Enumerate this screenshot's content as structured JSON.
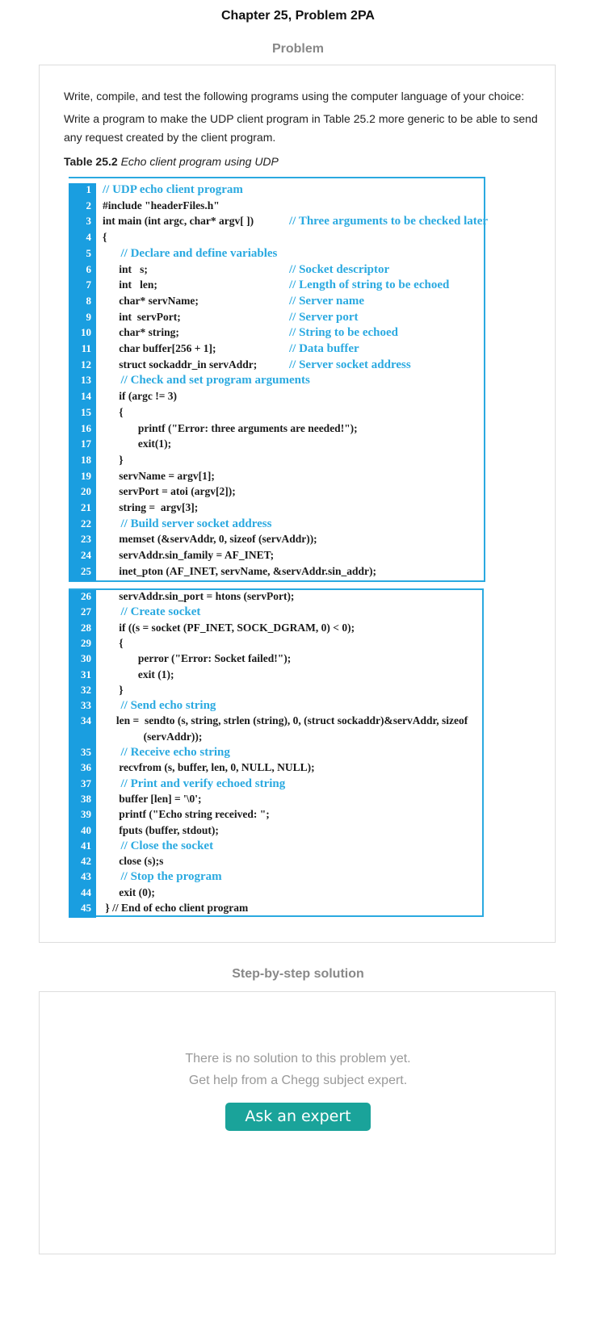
{
  "page": {
    "chapter_title": "Chapter 25, Problem 2PA",
    "problem_label": "Problem",
    "solution_label": "Step-by-step solution"
  },
  "problem": {
    "intro": "Write, compile, and test the following programs using the computer language of your choice:",
    "task": "Write a program to make the UDP client program in Table 25.2 more generic to be able to send any request created by the client program.",
    "table_caption_bold": "Table 25.2",
    "table_caption_italic": "Echo client program using UDP"
  },
  "code_block_1": [
    {
      "n": "1",
      "code": "// UDP echo client program",
      "comment": "",
      "is_comment": true
    },
    {
      "n": "2",
      "code": "#include \"headerFiles.h\"",
      "comment": "",
      "is_comment": false
    },
    {
      "n": "3",
      "code": "int main (int argc, char* argv[ ])",
      "comment": "// Three arguments to be checked later",
      "is_comment": false
    },
    {
      "n": "4",
      "code": "{",
      "comment": "",
      "is_comment": false
    },
    {
      "n": "5",
      "code": "      // Declare and define variables",
      "comment": "",
      "is_comment": true
    },
    {
      "n": "6",
      "code": "      int   s;",
      "comment": "// Socket descriptor",
      "is_comment": false
    },
    {
      "n": "7",
      "code": "      int   len;",
      "comment": "// Length of string to be echoed",
      "is_comment": false
    },
    {
      "n": "8",
      "code": "      char* servName;",
      "comment": "// Server name",
      "is_comment": false
    },
    {
      "n": "9",
      "code": "      int  servPort;",
      "comment": "// Server port",
      "is_comment": false
    },
    {
      "n": "10",
      "code": "      char* string;",
      "comment": "// String to be echoed",
      "is_comment": false
    },
    {
      "n": "11",
      "code": "      char buffer[256 + 1];",
      "comment": "// Data buffer",
      "is_comment": false
    },
    {
      "n": "12",
      "code": "      struct sockaddr_in servAddr;",
      "comment": "// Server socket address",
      "is_comment": false
    },
    {
      "n": "13",
      "code": "      // Check and set program arguments",
      "comment": "",
      "is_comment": true
    },
    {
      "n": "14",
      "code": "      if (argc != 3)",
      "comment": "",
      "is_comment": false
    },
    {
      "n": "15",
      "code": "      {",
      "comment": "",
      "is_comment": false
    },
    {
      "n": "16",
      "code": "             printf (\"Error: three arguments are needed!\");",
      "comment": "",
      "is_comment": false
    },
    {
      "n": "17",
      "code": "             exit(1);",
      "comment": "",
      "is_comment": false
    },
    {
      "n": "18",
      "code": "      }",
      "comment": "",
      "is_comment": false
    },
    {
      "n": "19",
      "code": "      servName = argv[1];",
      "comment": "",
      "is_comment": false
    },
    {
      "n": "20",
      "code": "      servPort = atoi (argv[2]);",
      "comment": "",
      "is_comment": false
    },
    {
      "n": "21",
      "code": "      string =  argv[3];",
      "comment": "",
      "is_comment": false
    },
    {
      "n": "22",
      "code": "      // Build server socket address",
      "comment": "",
      "is_comment": true
    },
    {
      "n": "23",
      "code": "      memset (&servAddr, 0, sizeof (servAddr));",
      "comment": "",
      "is_comment": false
    },
    {
      "n": "24",
      "code": "      servAddr.sin_family = AF_INET;",
      "comment": "",
      "is_comment": false
    },
    {
      "n": "25",
      "code": "      inet_pton (AF_INET, servName, &servAddr.sin_addr);",
      "comment": "",
      "is_comment": false
    }
  ],
  "code_block_2": [
    {
      "n": "26",
      "code": "      servAddr.sin_port = htons (servPort);",
      "comment": "",
      "is_comment": false
    },
    {
      "n": "27",
      "code": "      // Create socket",
      "comment": "",
      "is_comment": true
    },
    {
      "n": "28",
      "code": "      if ((s = socket (PF_INET, SOCK_DGRAM, 0) < 0);",
      "comment": "",
      "is_comment": false
    },
    {
      "n": "29",
      "code": "      {",
      "comment": "",
      "is_comment": false
    },
    {
      "n": "30",
      "code": "             perror (\"Error: Socket failed!\");",
      "comment": "",
      "is_comment": false
    },
    {
      "n": "31",
      "code": "             exit (1);",
      "comment": "",
      "is_comment": false
    },
    {
      "n": "32",
      "code": "      }",
      "comment": "",
      "is_comment": false
    },
    {
      "n": "33",
      "code": "      // Send echo string",
      "comment": "",
      "is_comment": true
    },
    {
      "n": "34",
      "code": "     len =  sendto (s, string, strlen (string), 0, (struct sockaddr)&servAddr, sizeof",
      "comment": "",
      "is_comment": false
    },
    {
      "n": "",
      "code": "               (servAddr));",
      "comment": "",
      "is_comment": false
    },
    {
      "n": "35",
      "code": "      // Receive echo string",
      "comment": "",
      "is_comment": true
    },
    {
      "n": "36",
      "code": "      recvfrom (s, buffer, len, 0, NULL, NULL);",
      "comment": "",
      "is_comment": false
    },
    {
      "n": "37",
      "code": "      // Print and verify echoed string",
      "comment": "",
      "is_comment": true
    },
    {
      "n": "38",
      "code": "      buffer [len] = '\\0';",
      "comment": "",
      "is_comment": false
    },
    {
      "n": "39",
      "code": "      printf (\"Echo string received: \";",
      "comment": "",
      "is_comment": false
    },
    {
      "n": "40",
      "code": "      fputs (buffer, stdout);",
      "comment": "",
      "is_comment": false
    },
    {
      "n": "41",
      "code": "      // Close the socket",
      "comment": "",
      "is_comment": true
    },
    {
      "n": "42",
      "code": "      close (s);s",
      "comment": "",
      "is_comment": false
    },
    {
      "n": "43",
      "code": "      // Stop the program",
      "comment": "",
      "is_comment": true
    },
    {
      "n": "44",
      "code": "      exit (0);",
      "comment": "",
      "is_comment": false
    },
    {
      "n": "45",
      "code": " } // End of echo client program",
      "comment": "",
      "is_comment": false
    }
  ],
  "solution": {
    "no_solution_text": "There is no solution to this problem yet.",
    "help_text": "Get help from a Chegg subject expert.",
    "ask_button_label": "Ask an expert"
  },
  "colors": {
    "line_number_bg": "#1a9ee0",
    "comment_color": "#2aa9e0",
    "button_bg": "#1aa39a"
  }
}
